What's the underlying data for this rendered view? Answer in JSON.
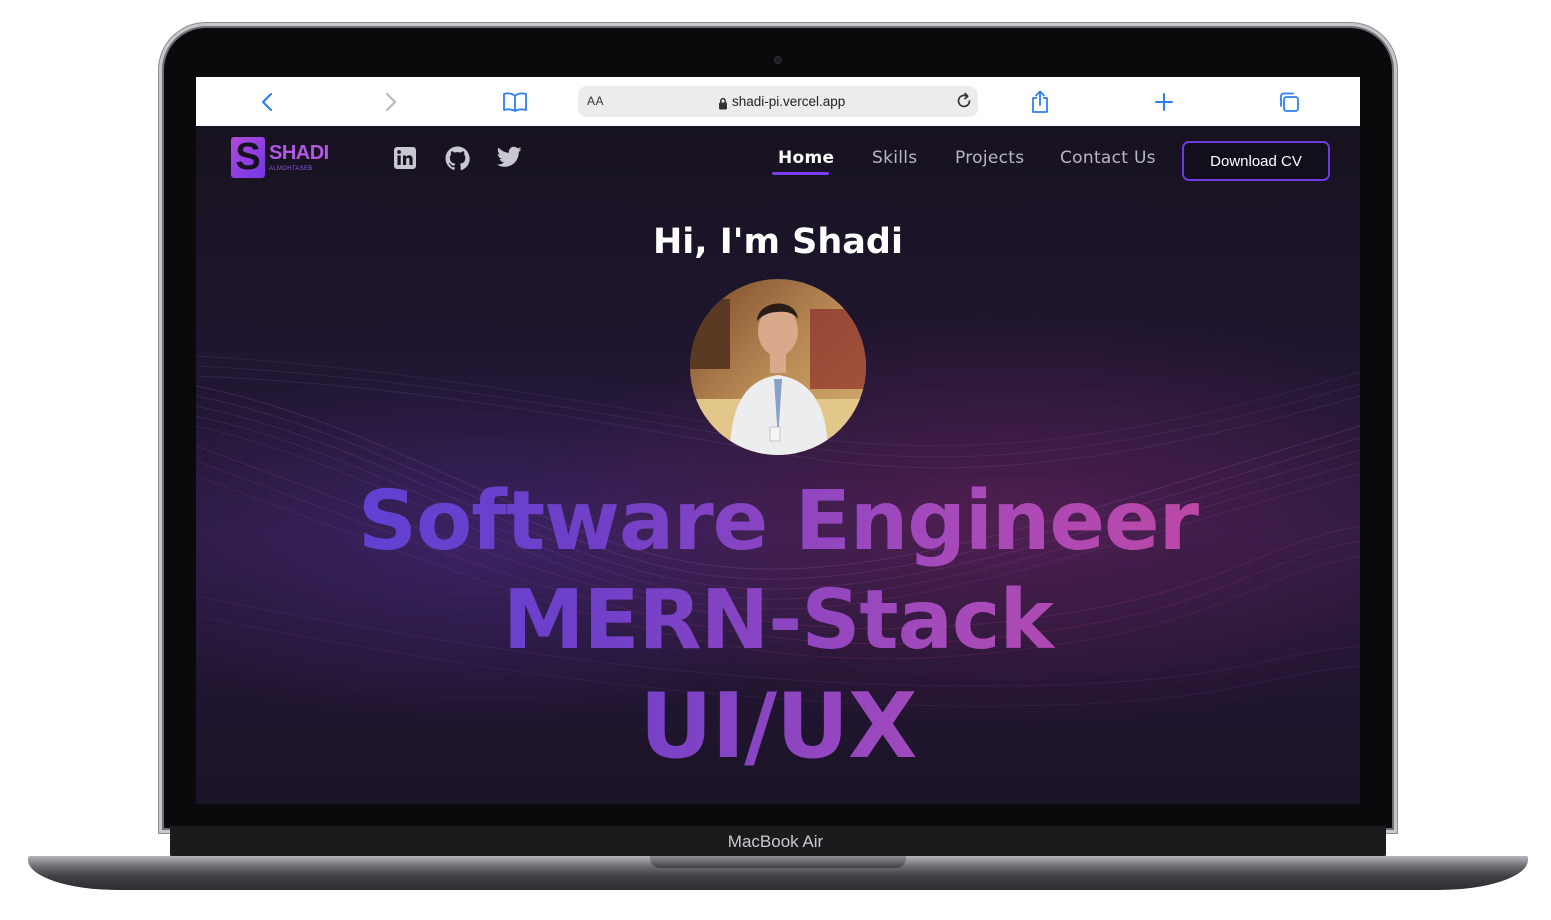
{
  "device": {
    "label": "MacBook Air"
  },
  "browser": {
    "text_size_label": "AA",
    "url": "shadi-pi.vercel.app"
  },
  "site": {
    "logo": {
      "letter": "S",
      "name": "SHADI",
      "subtitle": "ALMOHTASEB"
    },
    "social": [
      {
        "icon": "linkedin-icon"
      },
      {
        "icon": "github-icon"
      },
      {
        "icon": "twitter-icon"
      }
    ],
    "nav": {
      "items": [
        {
          "label": "Home",
          "active": true
        },
        {
          "label": "Skills",
          "active": false
        },
        {
          "label": "Projects",
          "active": false
        },
        {
          "label": "Contact Us",
          "active": false
        }
      ],
      "cta": "Download CV"
    },
    "hero": {
      "greeting": "Hi, I'm Shadi",
      "roles": [
        "Software Engineer",
        "MERN-Stack",
        "UI/UX"
      ]
    },
    "colors": {
      "accent": "#7b3df0",
      "gradient_start": "#5342d9",
      "gradient_end": "#c9479b",
      "background": "#1f1630"
    }
  }
}
